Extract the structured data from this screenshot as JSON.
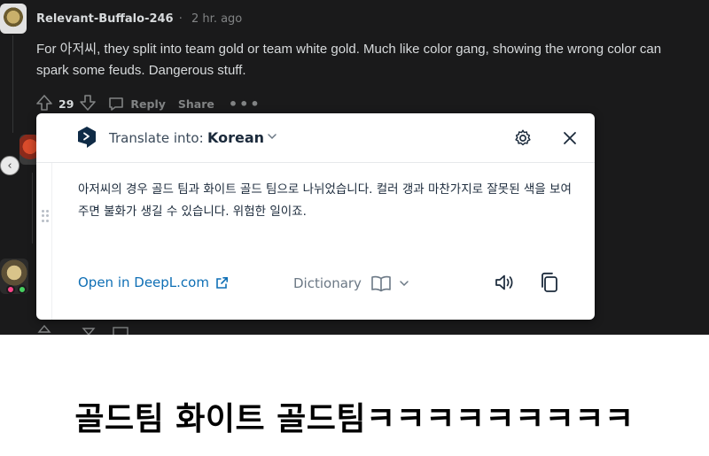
{
  "comment": {
    "author": "Relevant-Buffalo-246",
    "separator": "·",
    "time": "2 hr. ago",
    "body": "For 아저씨, they split into team gold or team white gold. Much like color gang, showing the wrong color can spark some feuds. Dangerous stuff.",
    "upvotes": "29",
    "reply_label": "Reply",
    "share_label": "Share",
    "more_label": "•••"
  },
  "popup": {
    "translate_into_label": "Translate into:",
    "language": "Korean",
    "translation": "아저씨의 경우 골드 팀과 화이트 골드 팀으로 나뉘었습니다. 컬러 갱과 마찬가지로 잘못된 색을 보여주면 불화가 생길 수 있습니다. 위험한 일이죠.",
    "open_link_label": "Open in DeepL.com",
    "dictionary_label": "Dictionary",
    "brand_color": "#0f2b46",
    "link_color": "#0f6fb5"
  },
  "caption": "골드팀 화이트 골드팀ㅋㅋㅋㅋㅋㅋㅋㅋㅋ"
}
